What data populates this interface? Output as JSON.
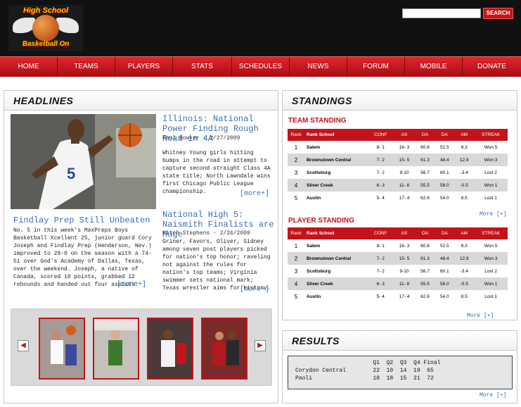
{
  "logo": {
    "top_text": "High School",
    "bottom_text": "Basketball On"
  },
  "search": {
    "placeholder": "",
    "button_label": "SEARCH"
  },
  "nav": [
    "HOME",
    "TEAMS",
    "PLAYERS",
    "STATS",
    "SCHEDULES",
    "NEWS",
    "FORUM",
    "MOBILE",
    "DONATE"
  ],
  "headlines": {
    "title": "HEADLINES",
    "stories": [
      {
        "title": "Illinois: National Power Finding Rough Road in 4A",
        "meta": "Paul Bowker - 2/27/2009",
        "body": "Whitney Young girls hitting bumps in the road in attempt to capture second straight Class 4A state title; North Lawndale wins first Chicago Public League championship.",
        "more": "[more+]"
      },
      {
        "title": "Findlay Prep Still Unbeaten",
        "meta": "",
        "body": "No. 5 in this week's MaxPreps Boys Basketball Xcellent 25, junior guard Cory Joseph and Findlay Prep (Henderson, Nev.) improved to 29-0 on the season with a 74-51 over God's Academy of Dallas, Texas, over the weekend. Joseph, a native of Canada, scored 10 points, grabbed 12 rebounds and handed out four assists.",
        "more": "[more+]"
      },
      {
        "title": "National High 5: Naismith Finalists are Huge",
        "meta": "Mitch Stephens - 2/26/2009",
        "body": "Griner, Favors, Oliver, Sidney among seven post players picked for nation's top honor; raveling not against the rules for nation's top teams; Virginia swimmer sets national mark; Texas wrestler aims for history.",
        "more": "[more+]"
      }
    ]
  },
  "gallery": {
    "prev": "◀",
    "next": "▶",
    "thumbs": [
      "thumb-1",
      "thumb-2",
      "thumb-3",
      "thumb-4"
    ]
  },
  "standings": {
    "title": "STANDINGS",
    "team_title": "TEAM STANDING",
    "player_title": "PLAYER STANDING",
    "headers": [
      "Rank",
      "Rank School",
      "CONF",
      "AS",
      "OA",
      "DA",
      "AM",
      "STREAK"
    ],
    "rows": [
      [
        "1",
        "Salem",
        "8- 1",
        "16- 3",
        "60.8",
        "52.5",
        "8.3",
        "Won 5"
      ],
      [
        "2",
        "Brownstown Central",
        "7- 2",
        "15- 5",
        "61.3",
        "48.4",
        "12.9",
        "Won 3"
      ],
      [
        "3",
        "Scottsburg",
        "7- 2",
        "9-10",
        "56.7",
        "60.1",
        "-3.4",
        "Lost 2"
      ],
      [
        "4",
        "Silver Creek",
        "6- 3",
        "11- 8",
        "55.5",
        "56.0",
        "-0.5",
        "Won 1"
      ],
      [
        "5",
        "Austin",
        "5- 4",
        "17- 4",
        "62.6",
        "54.0",
        "8.5",
        "Lost 1"
      ]
    ],
    "more": "More [+]"
  },
  "results": {
    "title": "RESULTS",
    "header": "                       Q1  Q2  Q3  Q4 Final",
    "row1": "Corydon Central        22  10  14  19  65",
    "row2": "Paoli                  18  18  15  21  72",
    "more": "More [+]"
  }
}
